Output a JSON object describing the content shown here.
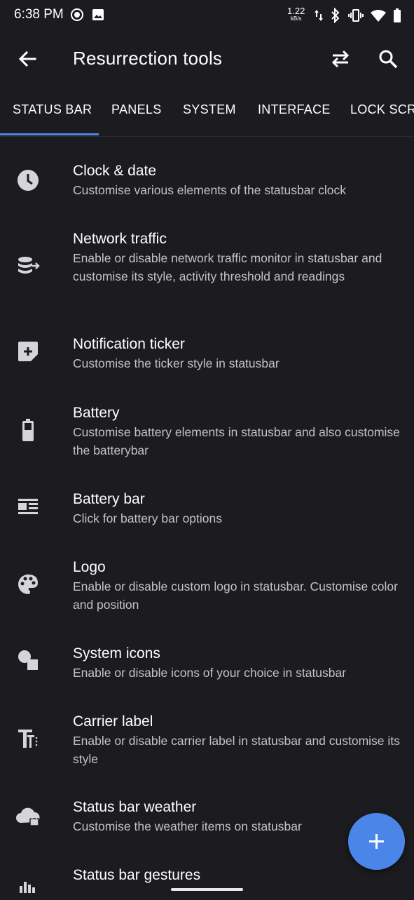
{
  "status_bar": {
    "time": "6:38 PM",
    "net_speed_value": "1.22",
    "net_speed_unit": "kB/s",
    "icons": [
      "media-playing-icon",
      "image-icon",
      "data-arrows-icon",
      "bluetooth-icon",
      "vibrate-icon",
      "wifi-icon",
      "battery-icon"
    ]
  },
  "toolbar": {
    "title": "Resurrection tools",
    "back_icon": "arrow-back-icon",
    "swap_icon": "swap-icon",
    "search_icon": "search-icon"
  },
  "tabs": [
    {
      "label": "STATUS BAR",
      "selected": true
    },
    {
      "label": "PANELS",
      "selected": false
    },
    {
      "label": "SYSTEM",
      "selected": false
    },
    {
      "label": "INTERFACE",
      "selected": false
    },
    {
      "label": "LOCK SCRE",
      "selected": false
    }
  ],
  "items": [
    {
      "title": "Clock & date",
      "subtitle": "Customise various elements of the statusbar clock",
      "icon": "clock-icon"
    },
    {
      "title": "Network traffic",
      "subtitle": "Enable or disable network traffic monitor in statusbar and customise its style, activity threshold and readings",
      "icon": "network-traffic-icon"
    },
    {
      "title": "Notification ticker",
      "subtitle": "Customise the ticker style in statusbar",
      "icon": "note-edit-icon"
    },
    {
      "title": "Battery",
      "subtitle": "Customise battery elements in statusbar and also customise the batterybar",
      "icon": "battery-icon"
    },
    {
      "title": "Battery bar",
      "subtitle": "Click for battery bar options",
      "icon": "article-icon"
    },
    {
      "title": "Logo",
      "subtitle": "Enable or disable custom logo in statusbar. Customise color and position",
      "icon": "palette-icon"
    },
    {
      "title": "System icons",
      "subtitle": "Enable or disable icons of your choice in statusbar",
      "icon": "shapes-icon"
    },
    {
      "title": "Carrier label",
      "subtitle": "Enable or disable carrier label in statusbar and customise its style",
      "icon": "text-format-icon"
    },
    {
      "title": "Status bar weather",
      "subtitle": "Customise the weather items on statusbar",
      "icon": "cloud-lock-icon"
    },
    {
      "title": "Status bar gestures",
      "subtitle": "",
      "icon": "equalizer-icon"
    }
  ],
  "fab": {
    "icon": "plus-icon"
  },
  "colors": {
    "background": "#1c1b1f",
    "accent": "#4a86e8",
    "text_primary": "#ffffff",
    "text_secondary": "#c4c2c8",
    "icon": "#d6d4da"
  }
}
